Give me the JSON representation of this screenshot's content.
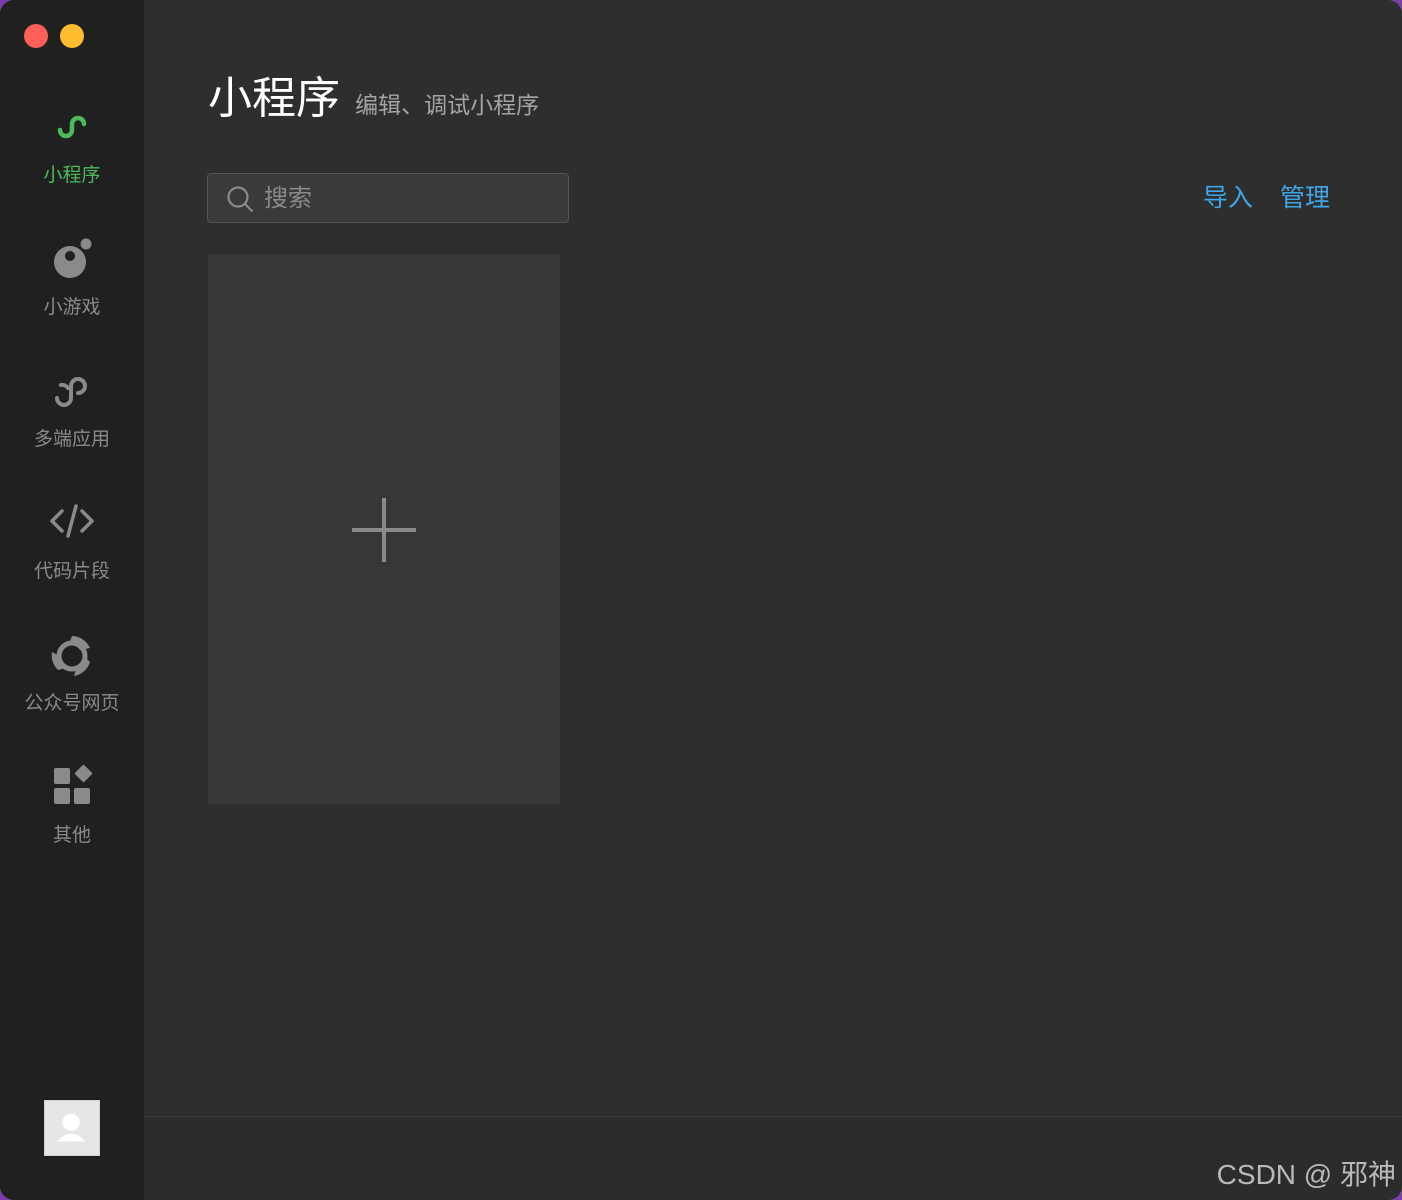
{
  "sidebar": {
    "items": [
      {
        "label": "小程序",
        "icon": "mini-program-icon",
        "active": true
      },
      {
        "label": "小游戏",
        "icon": "mini-game-icon",
        "active": false
      },
      {
        "label": "多端应用",
        "icon": "multi-platform-icon",
        "active": false
      },
      {
        "label": "代码片段",
        "icon": "code-snippet-icon",
        "active": false
      },
      {
        "label": "公众号网页",
        "icon": "official-account-web-icon",
        "active": false
      },
      {
        "label": "其他",
        "icon": "other-icon",
        "active": false
      }
    ]
  },
  "header": {
    "title": "小程序",
    "subtitle": "编辑、调试小程序"
  },
  "search": {
    "placeholder": "搜索"
  },
  "actions": {
    "import_label": "导入",
    "manage_label": "管理"
  },
  "watermark": "CSDN @ 邪神",
  "colors": {
    "accent_green": "#4cb95b",
    "link_blue": "#3fa6e8",
    "background": "#2e2e2e",
    "sidebar": "#202020"
  }
}
